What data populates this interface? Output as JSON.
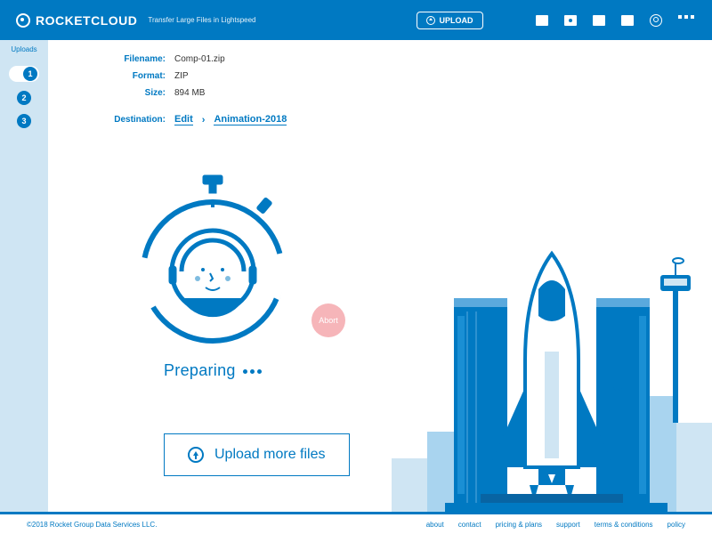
{
  "brand": {
    "name": "ROCKETCLOUD",
    "tagline": "Transfer Large Files in Lightspeed"
  },
  "header": {
    "upload_label": "UPLOAD",
    "icons": [
      "dashboard",
      "camera",
      "document",
      "folder",
      "account",
      "menu"
    ]
  },
  "sidebar": {
    "label": "Uploads",
    "items": [
      "1",
      "2",
      "3"
    ],
    "active_index": 0
  },
  "file": {
    "labels": {
      "filename": "Filename:",
      "format": "Format:",
      "size": "Size:"
    },
    "filename": "Comp-01.zip",
    "format": "ZIP",
    "size": "894 MB"
  },
  "destination": {
    "label": "Destination:",
    "edit_label": "Edit",
    "folder": "Animation-2018"
  },
  "status": {
    "text": "Preparing"
  },
  "abort": {
    "label": "Abort"
  },
  "more": {
    "label": "Upload more files"
  },
  "footer": {
    "copyright": "©2018 Rocket Group Data Services LLC.",
    "links": [
      "about",
      "contact",
      "pricing & plans",
      "support",
      "terms & conditions",
      "policy"
    ]
  },
  "colors": {
    "primary": "#0079c2",
    "light": "#cfe5f3",
    "accent_pink": "#f6b5b9"
  }
}
